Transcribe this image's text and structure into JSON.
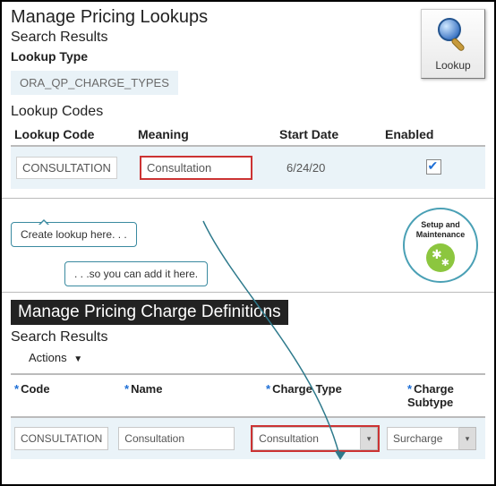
{
  "top": {
    "title": "Manage Pricing Lookups",
    "subtitle": "Search Results",
    "lookup_type_label": "Lookup Type",
    "lookup_type_value": "ORA_QP_CHARGE_TYPES",
    "lookup_codes_label": "Lookup Codes",
    "columns": {
      "code": "Lookup Code",
      "meaning": "Meaning",
      "start": "Start Date",
      "enabled": "Enabled"
    },
    "row": {
      "code": "CONSULTATION",
      "meaning": "Consultation",
      "start": "6/24/20",
      "enabled": true
    }
  },
  "lookup_badge": {
    "label": "Lookup"
  },
  "callouts": {
    "create": "Create lookup here. . .",
    "add": ". . .so you can add it here."
  },
  "setup_circle": {
    "line1": "Setup and",
    "line2": "Maintenance"
  },
  "bottom": {
    "title": "Manage Pricing Charge Definitions",
    "subtitle": "Search Results",
    "actions_label": "Actions",
    "columns": {
      "code": "Code",
      "name": "Name",
      "ctype": "Charge Type",
      "subtype": "Charge Subtype"
    },
    "row": {
      "code": "CONSULTATION",
      "name": "Consultation",
      "ctype": "Consultation",
      "subtype": "Surcharge"
    }
  }
}
